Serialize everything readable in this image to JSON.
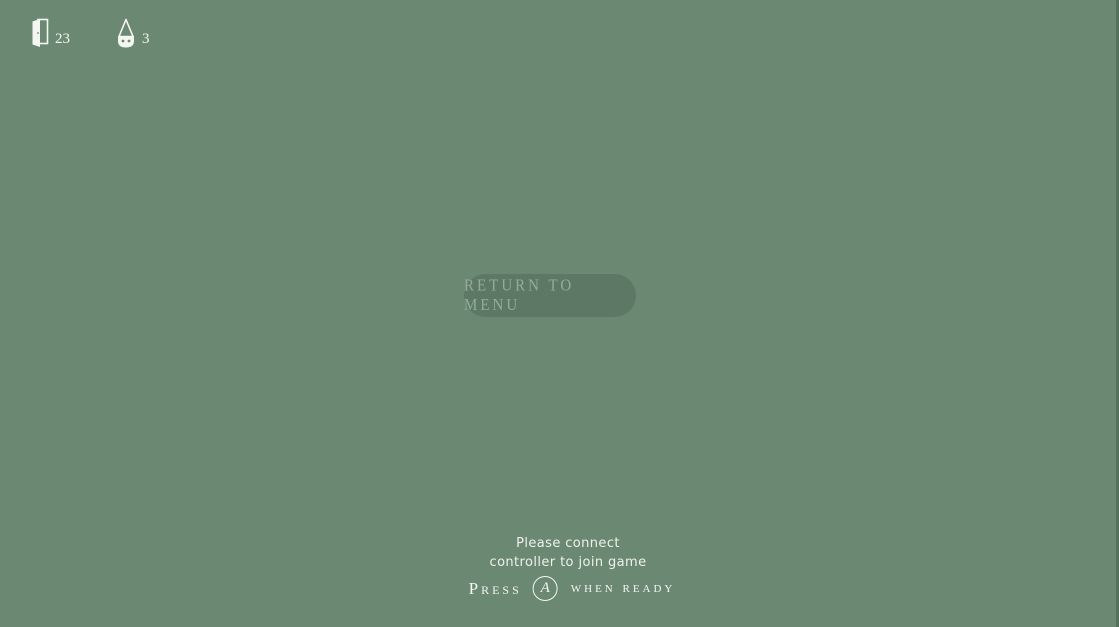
{
  "hud": {
    "doors": {
      "icon": "door-icon",
      "count": "23"
    },
    "lives": {
      "icon": "gnome-icon",
      "count": "3"
    }
  },
  "menu": {
    "return_label": "RETURN TO MENU"
  },
  "prompt": {
    "line1": "Please connect",
    "line2": "controller to join game",
    "press": "Press",
    "button": "A",
    "when_ready": "when ready"
  },
  "colors": {
    "background": "#6b8873",
    "button_bg": "#5d7965",
    "button_text": "#94ad9b",
    "text": "#f4f6f2"
  }
}
